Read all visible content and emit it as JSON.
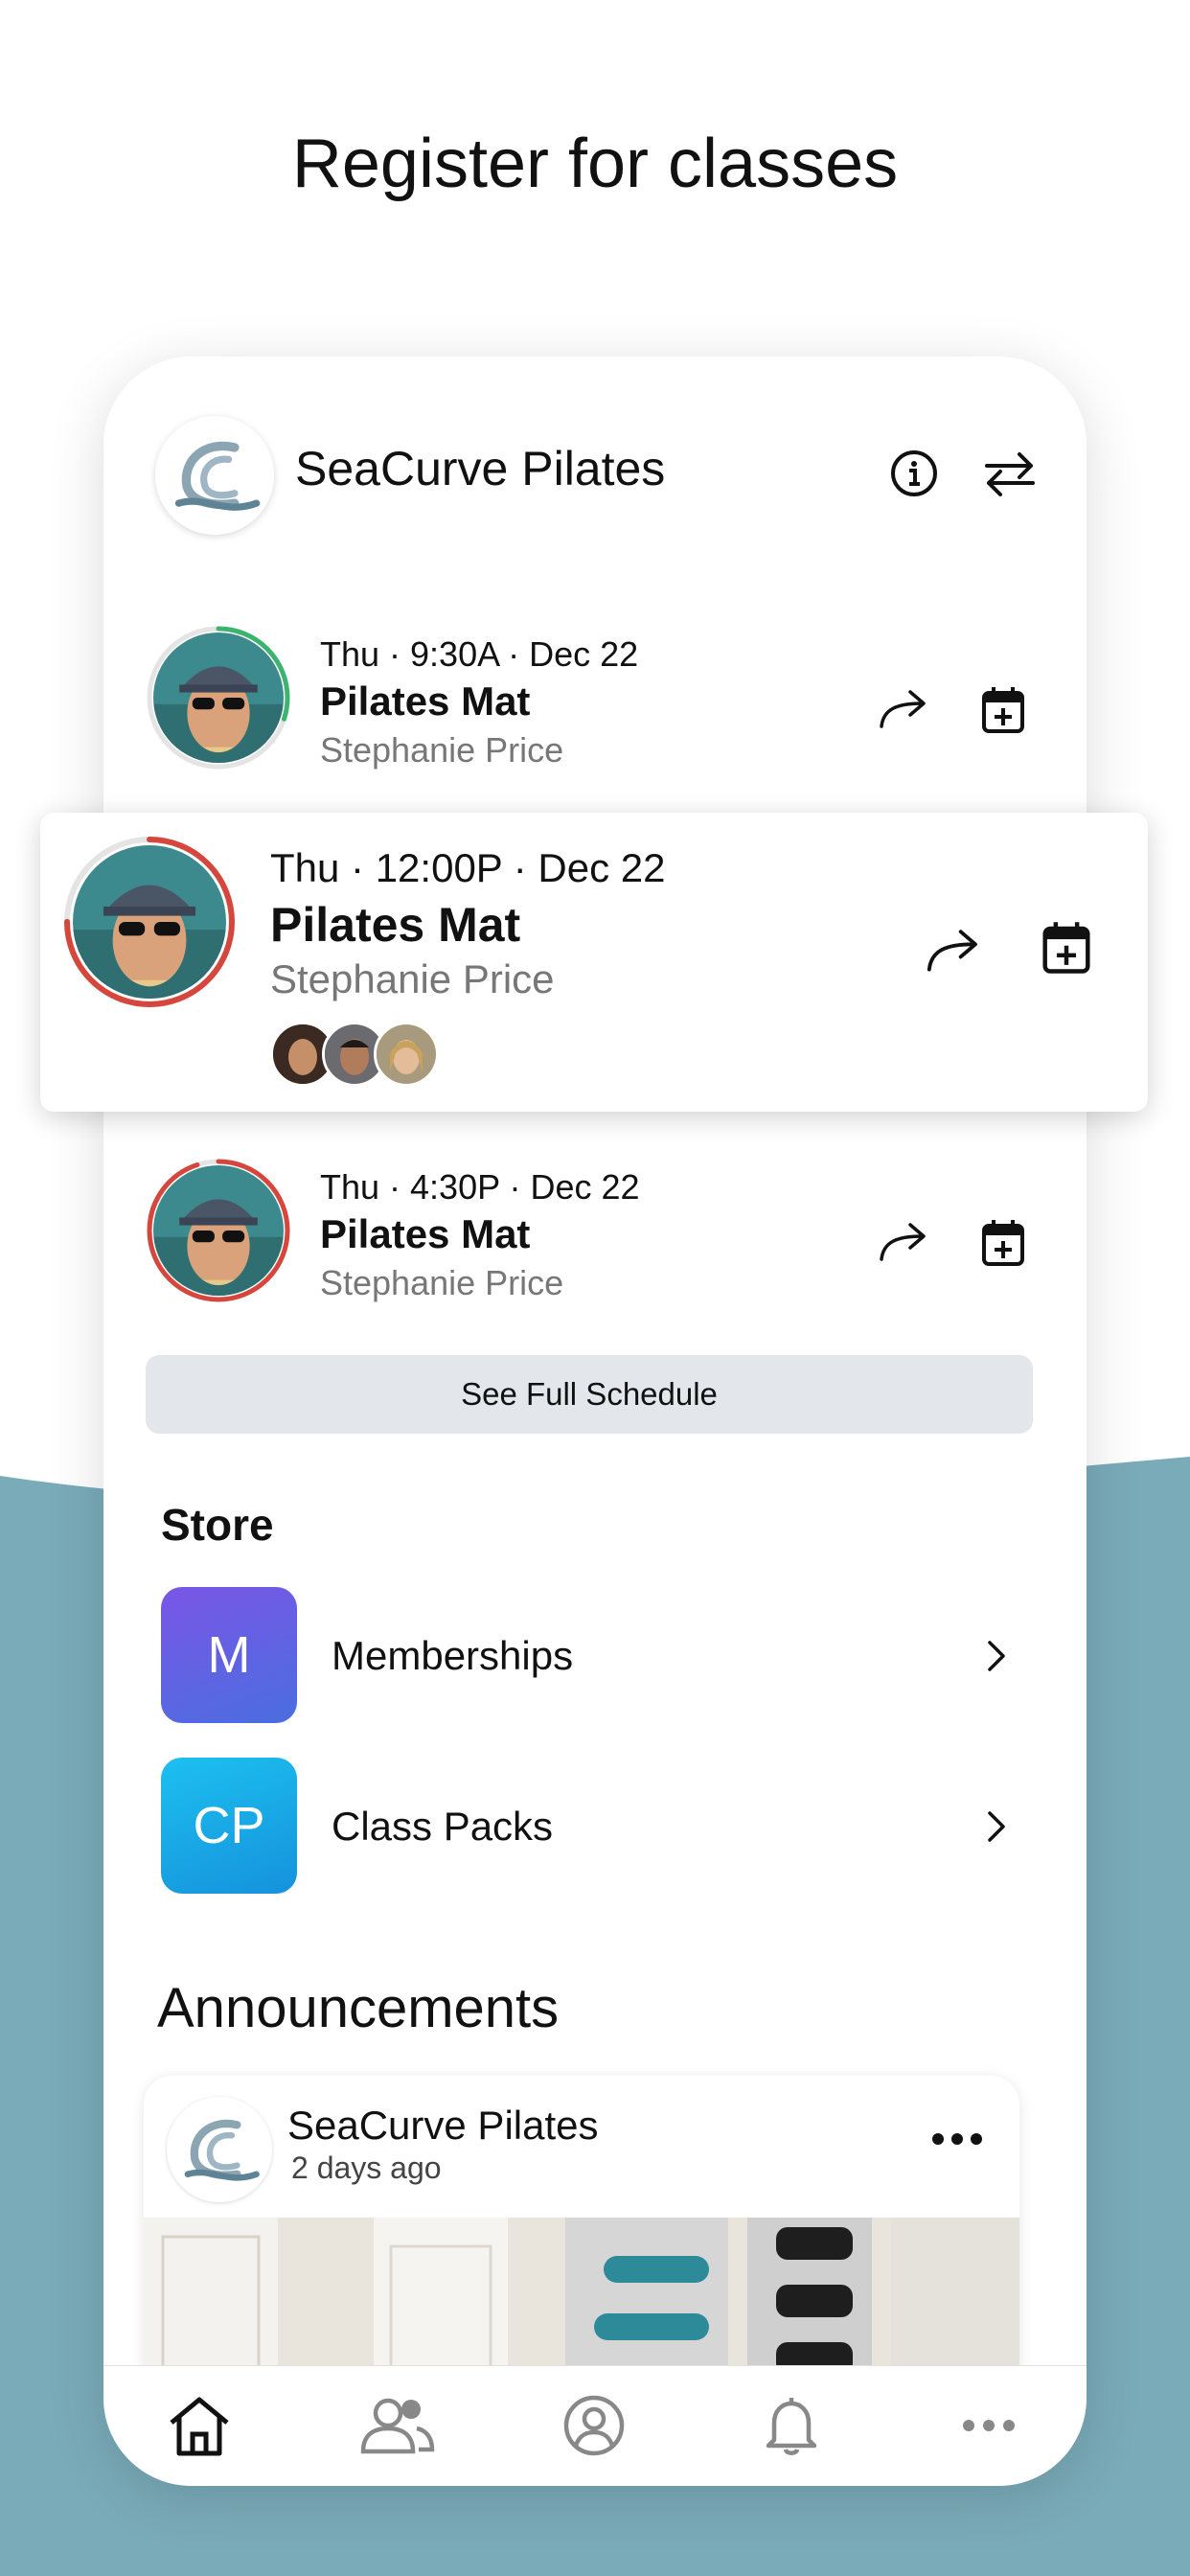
{
  "headline": "Register for classes",
  "colors": {
    "wave": "#7aabb9",
    "ring_green": "#3cb46e",
    "ring_red": "#d5463c",
    "memberships_badge": "#5b5fe0",
    "classpacks_badge": "#16a8e6"
  },
  "header": {
    "studio_name": "SeaCurve Pilates",
    "info_icon": "info-icon",
    "switch_icon": "switch-arrows-icon"
  },
  "classes": [
    {
      "time": "Thu · 9:30A · Dec 22",
      "name": "Pilates Mat",
      "instructor": "Stephanie Price",
      "ring": "green",
      "ring_fill": 0.3
    },
    {
      "time": "Thu · 12:00P · Dec 22",
      "name": "Pilates Mat",
      "instructor": "Stephanie Price",
      "ring": "red",
      "ring_fill": 0.75
    },
    {
      "time": "Thu · 4:30P · Dec 22",
      "name": "Pilates Mat",
      "instructor": "Stephanie Price",
      "ring": "red",
      "ring_fill": 0.95
    }
  ],
  "schedule_button": "See Full Schedule",
  "store": {
    "title": "Store",
    "items": [
      {
        "badge": "M",
        "label": "Memberships"
      },
      {
        "badge": "CP",
        "label": "Class Packs"
      }
    ]
  },
  "announcements": {
    "title": "Announcements",
    "post": {
      "author": "SeaCurve Pilates",
      "time": "2 days ago"
    }
  },
  "tabbar": [
    "home-icon",
    "people-icon",
    "profile-icon",
    "bell-icon",
    "more-icon"
  ]
}
